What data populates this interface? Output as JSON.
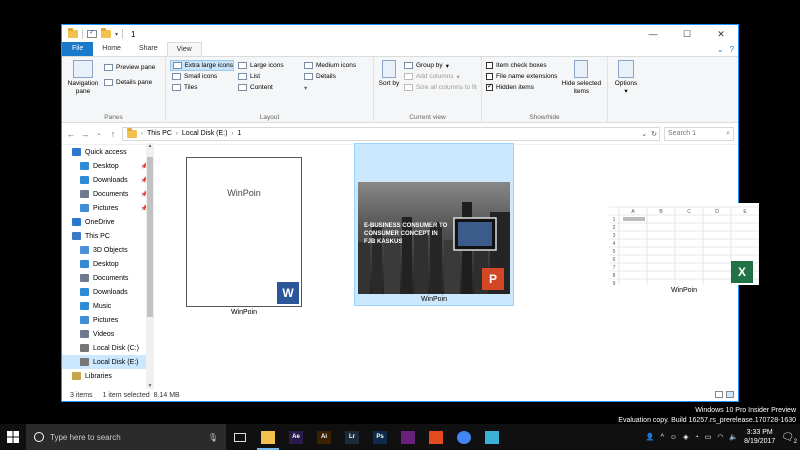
{
  "window": {
    "title": "1",
    "controls": {
      "minimize": "—",
      "maximize": "☐",
      "close": "✕"
    }
  },
  "ribbon_tabs": [
    "File",
    "Home",
    "Share",
    "View"
  ],
  "ribbon": {
    "panes": {
      "label": "Panes",
      "navigation_pane": "Navigation pane",
      "preview_pane": "Preview pane",
      "details_pane": "Details pane"
    },
    "layout": {
      "label": "Layout",
      "items": [
        "Extra large icons",
        "Large icons",
        "Medium icons",
        "Small icons",
        "List",
        "Details",
        "Tiles",
        "Content",
        ""
      ],
      "selected": "Extra large icons"
    },
    "current_view": {
      "label": "Current view",
      "sort_by": "Sort by",
      "group_by": "Group by",
      "add_columns": "Add columns",
      "size_all_columns": "Size all columns to fit"
    },
    "show_hide": {
      "label": "Show/hide",
      "item_check_boxes": "Item check boxes",
      "file_name_extensions": "File name extensions",
      "hidden_items": "Hidden items",
      "hidden_items_checked": true,
      "hide_selected_items": "Hide selected items"
    },
    "options": {
      "label": "Options"
    }
  },
  "address": {
    "path": [
      "This PC",
      "Local Disk (E:)",
      "1"
    ],
    "search_placeholder": "Search 1"
  },
  "nav_pane": {
    "items": [
      {
        "label": "Quick access",
        "icon": "star-icon",
        "indent": 0,
        "pinned": false
      },
      {
        "label": "Desktop",
        "icon": "desktop-icon",
        "indent": 1,
        "pinned": true
      },
      {
        "label": "Downloads",
        "icon": "download-icon",
        "indent": 1,
        "pinned": true
      },
      {
        "label": "Documents",
        "icon": "documents-icon",
        "indent": 1,
        "pinned": true
      },
      {
        "label": "Pictures",
        "icon": "pictures-icon",
        "indent": 1,
        "pinned": true
      },
      {
        "label": "OneDrive",
        "icon": "cloud-icon",
        "indent": 0,
        "pinned": false
      },
      {
        "label": "This PC",
        "icon": "computer-icon",
        "indent": 0,
        "pinned": false
      },
      {
        "label": "3D Objects",
        "icon": "cube-icon",
        "indent": 1,
        "pinned": false
      },
      {
        "label": "Desktop",
        "icon": "desktop-icon",
        "indent": 1,
        "pinned": false
      },
      {
        "label": "Documents",
        "icon": "documents-icon",
        "indent": 1,
        "pinned": false
      },
      {
        "label": "Downloads",
        "icon": "download-icon",
        "indent": 1,
        "pinned": false
      },
      {
        "label": "Music",
        "icon": "music-icon",
        "indent": 1,
        "pinned": false
      },
      {
        "label": "Pictures",
        "icon": "pictures-icon",
        "indent": 1,
        "pinned": false
      },
      {
        "label": "Videos",
        "icon": "videos-icon",
        "indent": 1,
        "pinned": false
      },
      {
        "label": "Local Disk (C:)",
        "icon": "drive-icon",
        "indent": 1,
        "pinned": false
      },
      {
        "label": "Local Disk (E:)",
        "icon": "drive-icon",
        "indent": 1,
        "pinned": false,
        "selected": true
      },
      {
        "label": "Libraries",
        "icon": "library-icon",
        "indent": 0,
        "pinned": false
      }
    ]
  },
  "files": [
    {
      "name": "WinPoin",
      "type": "word",
      "thumb_text": "WinPoin",
      "app_icon_letter": "W",
      "app_color": "#2b579a",
      "selected": false
    },
    {
      "name": "WinPoin",
      "type": "powerpoint",
      "thumb_text": "E-BUSINESS CONSUMER TO CONSUMER CONCEPT IN FJB KASKUS",
      "app_icon_letter": "P",
      "app_color": "#d24726",
      "selected": true
    },
    {
      "name": "WinPoin",
      "type": "excel",
      "columns": [
        "A",
        "B",
        "C",
        "D",
        "E"
      ],
      "rows": [
        "1",
        "2",
        "3",
        "4",
        "5",
        "6",
        "7",
        "8",
        "9"
      ],
      "app_icon_letter": "X",
      "app_color": "#217346",
      "selected": false
    }
  ],
  "status": {
    "item_count": "3 items",
    "selection": "1 item selected",
    "size": "8.14 MB"
  },
  "watermark": {
    "line1": "Windows 10 Pro Insider Preview",
    "line2": "Evaluation copy. Build 16257.rs_prerelease.170728-1630"
  },
  "taskbar": {
    "search_placeholder": "Type here to search",
    "apps": [
      {
        "name": "task-view",
        "label": "",
        "color": "#101010"
      },
      {
        "name": "file-explorer",
        "label": "",
        "color": "#f2c14e",
        "active": true
      },
      {
        "name": "after-effects",
        "label": "Ae",
        "color": "#2a1c4a"
      },
      {
        "name": "illustrator",
        "label": "Ai",
        "color": "#3a2100"
      },
      {
        "name": "lightroom",
        "label": "Lr",
        "color": "#1c2b3a"
      },
      {
        "name": "photoshop",
        "label": "Ps",
        "color": "#0f2a4a"
      },
      {
        "name": "visual-studio",
        "label": "",
        "color": "#68217a"
      },
      {
        "name": "red-app",
        "label": "",
        "color": "#e24a1f"
      },
      {
        "name": "chrome",
        "label": "",
        "color": "#4285f4"
      },
      {
        "name": "store-app",
        "label": "",
        "color": "#3ab0d8"
      }
    ],
    "time": "3:33 PM",
    "date": "8/19/2017",
    "notification_count": "2"
  }
}
